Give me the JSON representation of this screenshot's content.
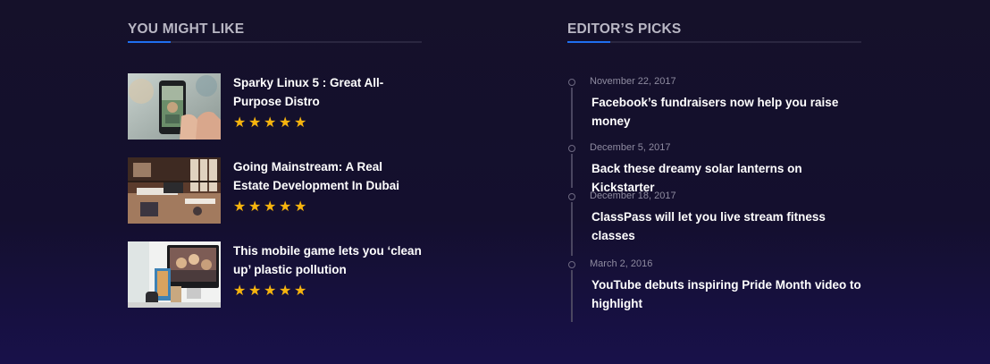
{
  "you_might_like": {
    "heading": "YOU MIGHT LIKE",
    "items": [
      {
        "title": "Sparky Linux 5 : Great All-Purpose Distro",
        "rating": 5,
        "thumb": "phone-photo-thumbnail"
      },
      {
        "title": "Going Mainstream: A Real Estate Development In Dubai",
        "rating": 5,
        "thumb": "office-interior-thumbnail"
      },
      {
        "title": "This mobile game lets you ‘clean up’ plastic pollution",
        "rating": 5,
        "thumb": "desktop-computer-thumbnail"
      }
    ],
    "star_glyph": "★"
  },
  "editors_picks": {
    "heading": "EDITOR’S PICKS",
    "items": [
      {
        "date": "November 22, 2017",
        "title": "Facebook’s fundraisers now help you raise money"
      },
      {
        "date": "December 5, 2017",
        "title": "Back these dreamy solar lanterns on Kickstarter"
      },
      {
        "date": "December 18, 2017",
        "title": "ClassPass will let you live stream fitness classes"
      },
      {
        "date": "March 2, 2016",
        "title": "YouTube debuts inspiring Pride Month video to highlight"
      }
    ]
  },
  "colors": {
    "background": "#15112a",
    "accent": "#1f6ff0",
    "star": "#f6b40e",
    "heading_text": "#b9b7c4",
    "date_text": "#8e8ba0"
  }
}
